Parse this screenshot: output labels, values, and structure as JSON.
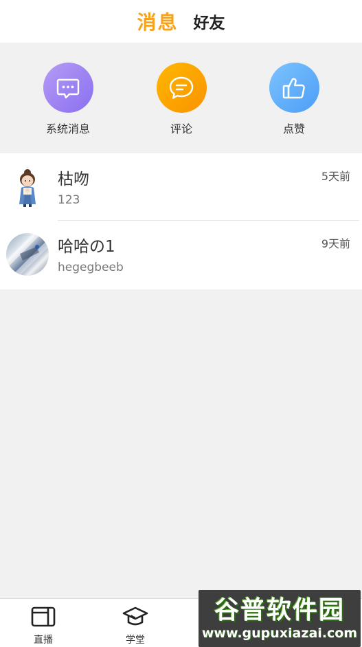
{
  "header": {
    "tab_messages": "消息",
    "tab_friends": "好友",
    "active_color": "#f7a21c"
  },
  "quick_actions": [
    {
      "label": "系统消息",
      "icon": "message-dots-icon",
      "color": "#9a80f2"
    },
    {
      "label": "评论",
      "icon": "comment-icon",
      "color": "#ffa500"
    },
    {
      "label": "点赞",
      "icon": "thumbs-up-icon",
      "color": "#5aa8f7"
    }
  ],
  "conversations": [
    {
      "name": "枯吻",
      "preview": "123",
      "time": "5天前",
      "avatar": "cartoon-girl-avatar"
    },
    {
      "name": "哈哈の1",
      "preview": "hegegbeeb",
      "time": "9天前",
      "avatar": "photo-avatar"
    }
  ],
  "bottom_nav": [
    {
      "label": "直播",
      "icon": "video-camera-icon"
    },
    {
      "label": "学堂",
      "icon": "graduation-cap-icon"
    }
  ],
  "watermark": {
    "title": "谷普软件园",
    "url": "www.gupuxiazai.com"
  }
}
